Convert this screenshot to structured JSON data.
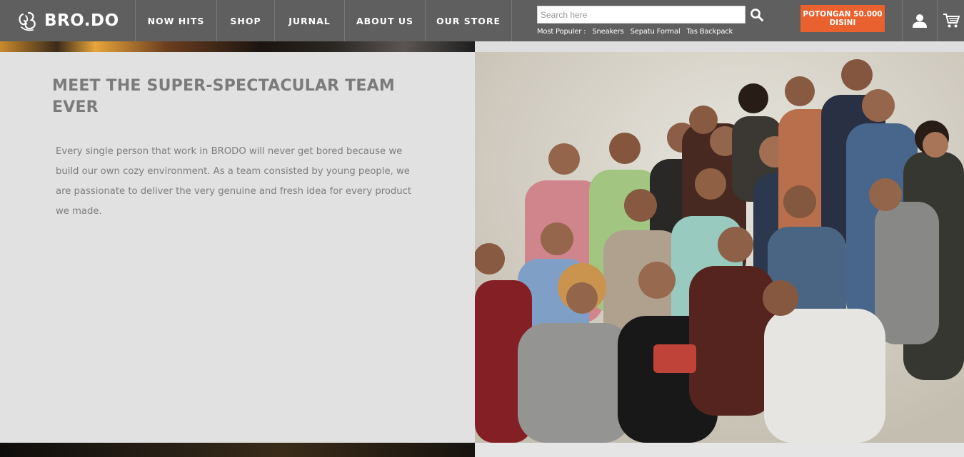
{
  "brand": {
    "name": "BRO.DO"
  },
  "nav": {
    "items": [
      {
        "label": "NOW HITS"
      },
      {
        "label": "SHOP"
      },
      {
        "label": "JURNAL"
      },
      {
        "label": "ABOUT US"
      },
      {
        "label": "OUR STORE"
      }
    ]
  },
  "search": {
    "placeholder": "Search here",
    "value": "",
    "popular_label": "Most Populer :",
    "popular": [
      "Sneakers",
      "Sepatu Formal",
      "Tas Backpack"
    ]
  },
  "promo": {
    "line1": "POTONGAN 50.000",
    "line2": "DISINI"
  },
  "team": {
    "heading": "MEET THE SUPER-SPECTACULAR TEAM EVER",
    "body": "Every single person that work in BRODO will never get bored because we build our own cozy environment. As a team consisted by young people, we are passionate to deliver the very genuine and fresh idea for every product we made."
  },
  "colors": {
    "header_bg": "#5f5f5f",
    "promo_bg": "#e8612e",
    "heading": "#7b7b7b",
    "panel_bg": "#e1e1e1"
  }
}
